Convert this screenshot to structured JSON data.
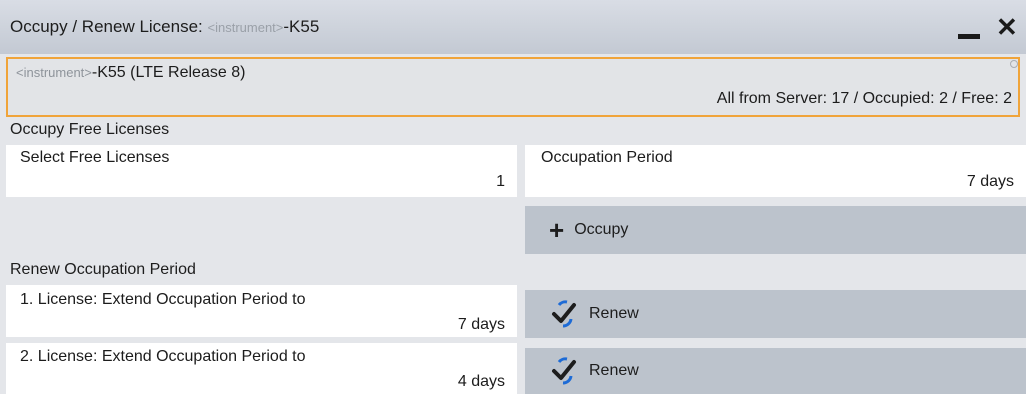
{
  "window": {
    "title_prefix": "Occupy / Renew License:",
    "title_placeholder": "<instrument>",
    "title_suffix": "-K55"
  },
  "product": {
    "placeholder": "<instrument>",
    "name": "-K55 (LTE Release 8)",
    "counts": "All from Server: 17 / Occupied: 2 / Free: 2"
  },
  "occupy": {
    "section_title": "Occupy Free Licenses",
    "select_label": "Select Free Licenses",
    "select_value": "1",
    "period_label": "Occupation Period",
    "period_value": "7 days",
    "button_label": "Occupy"
  },
  "renew": {
    "section_title": "Renew Occupation Period",
    "rows": [
      {
        "label": "1. License: Extend Occupation Period to",
        "value": "7 days",
        "button": "Renew"
      },
      {
        "label": "2. License: Extend Occupation Period to",
        "value": "4 days",
        "button": "Renew"
      }
    ]
  },
  "icons": {
    "minimize": "minimize-icon",
    "close": "close-icon",
    "occupy": "plus-icon",
    "renew": "renew-check-icon"
  },
  "colors": {
    "highlight_border": "#f0a43a",
    "button_bg": "#bcc3cc",
    "renew_icon": "#1d6bd6"
  }
}
